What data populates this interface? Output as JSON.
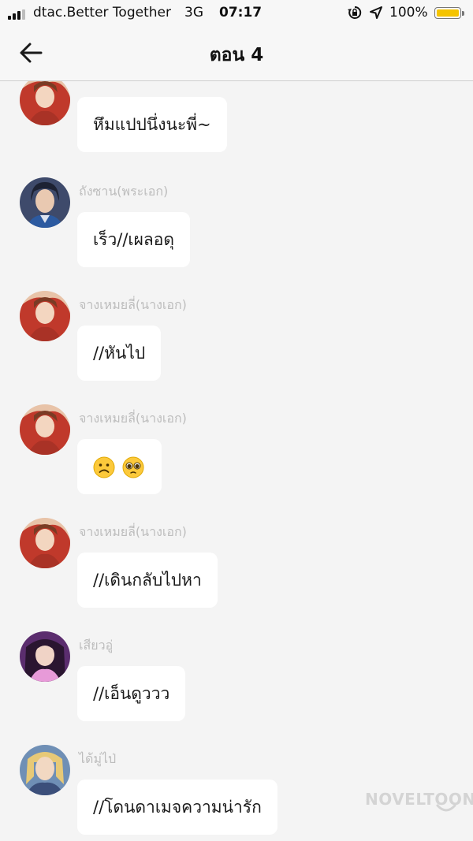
{
  "status_bar": {
    "carrier": "dtac.Better Together",
    "network": "3G",
    "time": "07:17",
    "battery": "100%",
    "icons": [
      "signal-icon",
      "rotation-lock-icon",
      "location-arrow-icon",
      "battery-icon"
    ]
  },
  "header": {
    "title": "ตอน 4",
    "back_icon": "back-arrow-icon"
  },
  "messages": [
    {
      "name": "",
      "text": "หึมแปปนึ่งนะพี่~",
      "avatar": "female-lead-avatar"
    },
    {
      "name": "ถังซาน(พระเอก)",
      "text": "เร็ว//เผลอดุ",
      "avatar": "male-lead-avatar"
    },
    {
      "name": "จางเหมยลี่(นางเอก)",
      "text": "//หันไป",
      "avatar": "female-lead-avatar"
    },
    {
      "name": "จางเหมยลี่(นางเอก)",
      "text": "",
      "emojis": [
        "frowning-face-emoji",
        "pleading-face-emoji"
      ],
      "avatar": "female-lead-avatar"
    },
    {
      "name": "จางเหมยลี่(นางเอก)",
      "text": "//เดินกลับไปหา",
      "avatar": "female-lead-avatar"
    },
    {
      "name": "เสียวอู่",
      "text": "//เอ็นดูววว",
      "avatar": "xiao-wu-avatar"
    },
    {
      "name": "ได้มู่ไป่",
      "text": "//โดนดาเมจความน่ารัก",
      "avatar": "blonde-male-avatar"
    }
  ],
  "watermark": "NOVELTOON",
  "colors": {
    "background": "#f4f4f4",
    "bubble": "#ffffff",
    "name": "#bdbdbd",
    "battery": "#f5c400"
  }
}
